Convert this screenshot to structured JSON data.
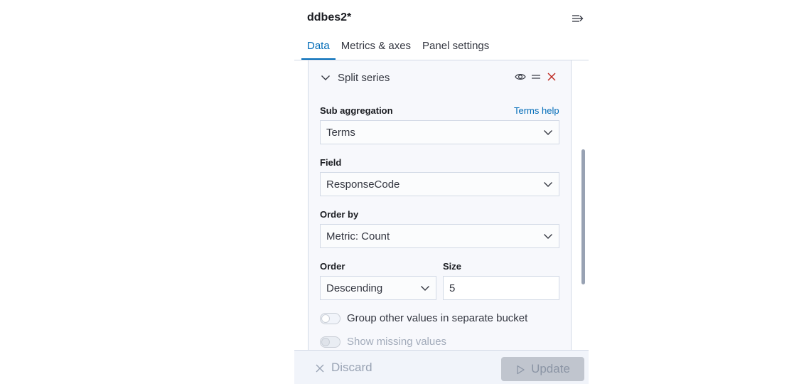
{
  "sidebar": {
    "title": "ddbes2*",
    "tabs": [
      {
        "label": "Data",
        "active": true
      },
      {
        "label": "Metrics & axes",
        "active": false
      },
      {
        "label": "Panel settings",
        "active": false
      }
    ]
  },
  "split_series": {
    "title": "Split series",
    "actions": [
      "eye-icon",
      "drag-handle-icon",
      "remove-icon"
    ],
    "sub_aggregation": {
      "label": "Sub aggregation",
      "help_link": "Terms help",
      "value": "Terms"
    },
    "field": {
      "label": "Field",
      "value": "ResponseCode"
    },
    "order_by": {
      "label": "Order by",
      "value": "Metric: Count"
    },
    "order": {
      "label": "Order",
      "value": "Descending"
    },
    "size": {
      "label": "Size",
      "value": "5"
    },
    "toggles": [
      {
        "label": "Group other values in separate bucket",
        "checked": false,
        "disabled": false
      },
      {
        "label": "Show missing values",
        "checked": false,
        "disabled": true
      }
    ]
  },
  "footer": {
    "discard_label": "Discard",
    "update_label": "Update"
  },
  "colors": {
    "accent": "#006bb8",
    "danger": "#bd271e",
    "panel_bg": "#f7f8fc",
    "border": "#d3dae6",
    "disabled_button": "#c0c5ce"
  }
}
